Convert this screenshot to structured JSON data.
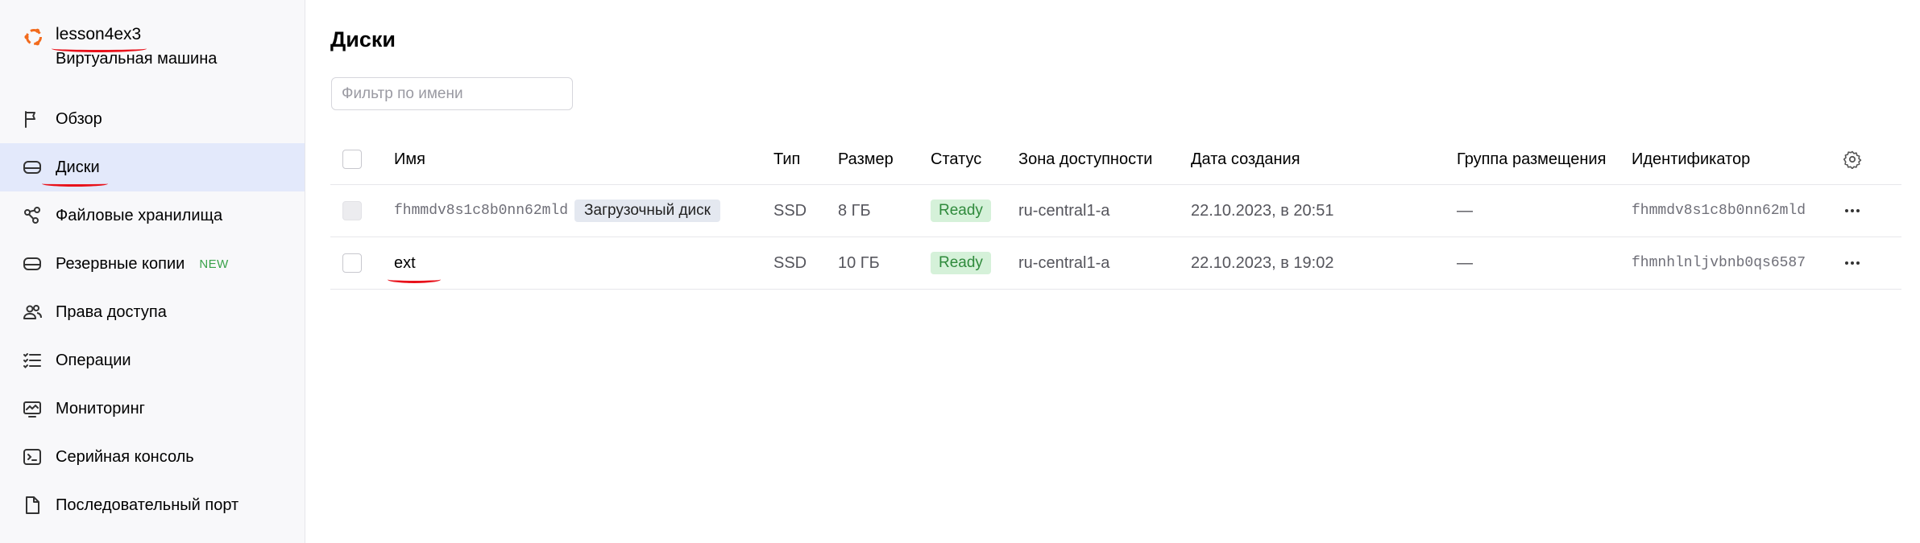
{
  "vm": {
    "name": "lesson4ex3",
    "subtitle": "Виртуальная машина"
  },
  "colors": {
    "brand_orange": "#f26b1d",
    "active_nav_bg": "#e3e9fb",
    "status_green": "#2f8a3c",
    "annotation_red": "#e8121b"
  },
  "nav": [
    {
      "label": "Обзор",
      "icon": "flag-icon"
    },
    {
      "label": "Диски",
      "icon": "disk-icon",
      "active": true
    },
    {
      "label": "Файловые хранилища",
      "icon": "share-icon"
    },
    {
      "label": "Резервные копии",
      "icon": "backup-disk-icon",
      "badge": "NEW"
    },
    {
      "label": "Права доступа",
      "icon": "persons-icon"
    },
    {
      "label": "Операции",
      "icon": "list-icon"
    },
    {
      "label": "Мониторинг",
      "icon": "monitor-icon"
    },
    {
      "label": "Серийная консоль",
      "icon": "terminal-icon"
    },
    {
      "label": "Последовательный порт",
      "icon": "file-icon"
    }
  ],
  "page": {
    "title": "Диски",
    "filter_placeholder": "Фильтр по имени",
    "filter_value": ""
  },
  "table": {
    "columns": {
      "name": "Имя",
      "type": "Тип",
      "size": "Размер",
      "status": "Статус",
      "zone": "Зона доступности",
      "created": "Дата создания",
      "placement": "Группа размещения",
      "id": "Идентификатор"
    },
    "rows": [
      {
        "name": "fhmmdv8s1c8b0nn62mld",
        "tag": "Загрузочный диск",
        "type": "SSD",
        "size": "8 ГБ",
        "status": "Ready",
        "zone": "ru-central1-a",
        "created": "22.10.2023, в 20:51",
        "placement": "—",
        "id": "fhmmdv8s1c8b0nn62mld"
      },
      {
        "name": "ext",
        "tag": "",
        "type": "SSD",
        "size": "10 ГБ",
        "status": "Ready",
        "zone": "ru-central1-a",
        "created": "22.10.2023, в 19:02",
        "placement": "—",
        "id": "fhmnhlnljvbnb0qs6587"
      }
    ]
  }
}
